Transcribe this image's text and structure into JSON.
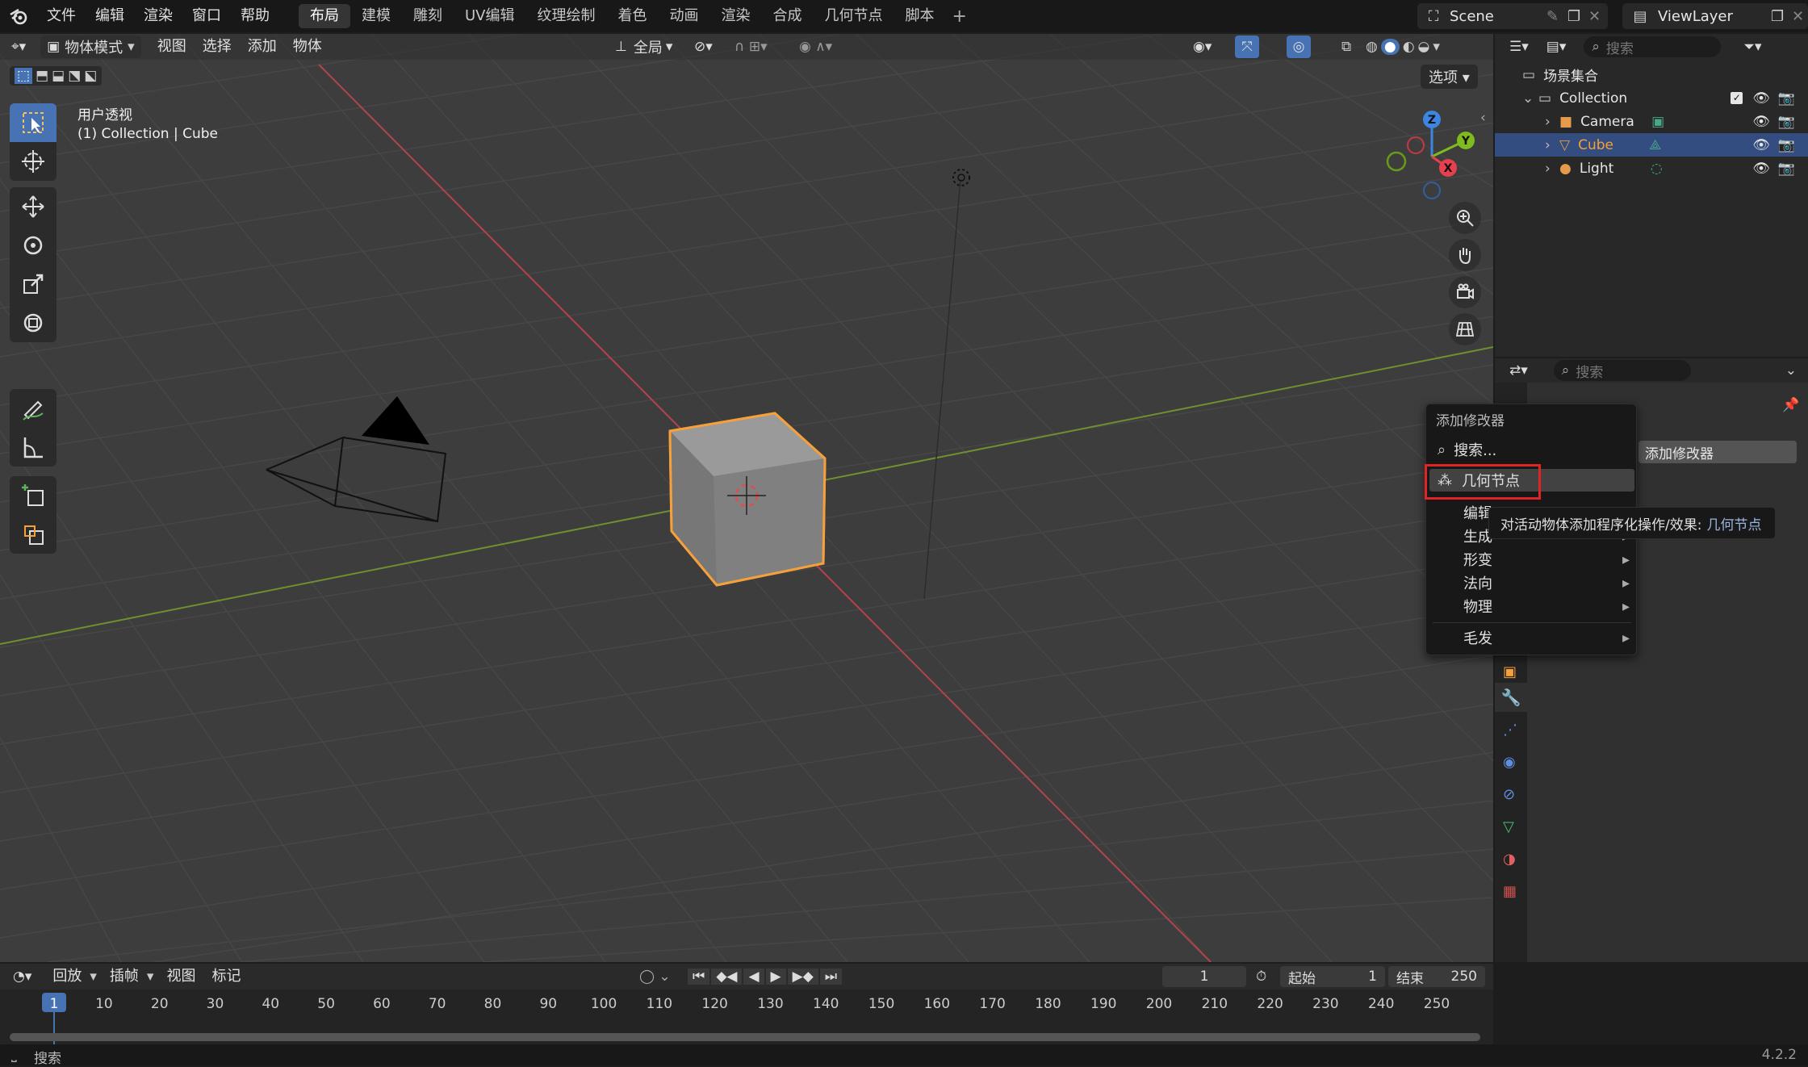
{
  "topbar": {
    "menus": [
      "文件",
      "编辑",
      "渲染",
      "窗口",
      "帮助"
    ],
    "workspaces": [
      {
        "label": "布局",
        "active": true
      },
      {
        "label": "建模",
        "active": false
      },
      {
        "label": "雕刻",
        "active": false
      },
      {
        "label": "UV编辑",
        "active": false
      },
      {
        "label": "纹理绘制",
        "active": false
      },
      {
        "label": "着色",
        "active": false
      },
      {
        "label": "动画",
        "active": false
      },
      {
        "label": "渲染",
        "active": false
      },
      {
        "label": "合成",
        "active": false
      },
      {
        "label": "几何节点",
        "active": false
      },
      {
        "label": "脚本",
        "active": false
      }
    ],
    "add_workspace": "+",
    "scene": "Scene",
    "view_layer": "ViewLayer"
  },
  "viewport_header": {
    "mode": "物体模式",
    "menus": [
      "视图",
      "选择",
      "添加",
      "物体"
    ],
    "transform_orientation": "全局",
    "options": "选项"
  },
  "viewport_overlay": {
    "view_name": "用户透视",
    "object_info": "(1) Collection | Cube"
  },
  "gizmo": {
    "x": "X",
    "y": "Y",
    "z": "Z"
  },
  "toolbar_icons": [
    "select-box-icon",
    "cursor-icon",
    "move-icon",
    "rotate-icon",
    "scale-icon",
    "transform-icon",
    "annotate-icon",
    "measure-icon",
    "add-cube-icon",
    "extrude-icon"
  ],
  "outliner": {
    "search_placeholder": "搜索",
    "root": "场景集合",
    "collection": "Collection",
    "items": [
      {
        "label": "Camera",
        "icon": "camera-icon",
        "selected": false
      },
      {
        "label": "Cube",
        "icon": "mesh-icon",
        "selected": true
      },
      {
        "label": "Light",
        "icon": "light-icon",
        "selected": false
      }
    ]
  },
  "properties": {
    "search_placeholder": "搜索",
    "add_modifier_button": "添加修改器",
    "tabs": [
      "object-icon",
      "wrench-icon",
      "particles-icon",
      "physics-icon",
      "constraints-icon",
      "data-icon",
      "material-icon",
      "texture-icon"
    ]
  },
  "context_menu": {
    "title": "添加修改器",
    "search": "搜索...",
    "highlighted": "几何节点",
    "items": [
      {
        "label": "编辑",
        "submenu": true
      },
      {
        "label": "生成",
        "submenu": true
      },
      {
        "label": "形变",
        "submenu": true
      },
      {
        "label": "法向",
        "submenu": true
      },
      {
        "label": "物理",
        "submenu": true
      },
      {
        "label": "毛发",
        "submenu": true
      }
    ],
    "submenu_arrow": "▸"
  },
  "tooltip": {
    "text": "对活动物体添加程序化操作/效果: ",
    "emphasis": "几何节点"
  },
  "timeline": {
    "menus": [
      "回放",
      "插帧",
      "视图",
      "标记"
    ],
    "current_frame": "1",
    "start_label": "起始",
    "start": "1",
    "end_label": "结束",
    "end": "250",
    "ticks": [
      "1",
      "10",
      "20",
      "30",
      "40",
      "50",
      "60",
      "70",
      "80",
      "90",
      "100",
      "110",
      "120",
      "130",
      "140",
      "150",
      "160",
      "170",
      "180",
      "190",
      "200",
      "210",
      "220",
      "230",
      "240",
      "250"
    ]
  },
  "statusbar": {
    "search": "搜索",
    "version": "4.2.2"
  },
  "colors": {
    "accent": "#4772b3",
    "selection_orange": "#f5a03a",
    "highlight_red": "#e02424",
    "axis_x": "#e6404e",
    "axis_y": "#7fbb1c",
    "axis_z": "#3b86e0"
  }
}
